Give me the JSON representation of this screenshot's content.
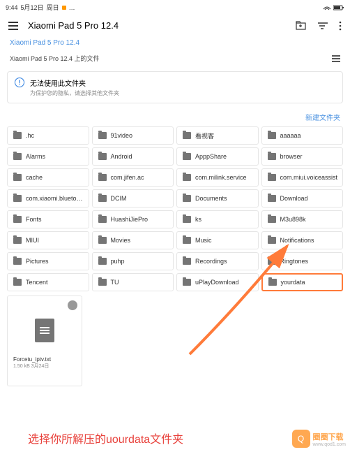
{
  "status": {
    "time": "9:44",
    "date": "5月12日",
    "day": "周日"
  },
  "header": {
    "title": "Xiaomi Pad 5 Pro 12.4"
  },
  "breadcrumb": "Xiaomi Pad 5 Pro 12.4",
  "path_label": "Xiaomi Pad 5 Pro 12.4 上的文件",
  "info": {
    "title": "无法使用此文件夹",
    "sub": "为保护您的隐私，请选择其他文件夹"
  },
  "new_folder": "新建文件夹",
  "folders": [
    ".hc",
    "91video",
    "看视客",
    "aaaaaa",
    "Alarms",
    "Android",
    "ApppShare",
    "browser",
    "cache",
    "com.jifen.ac",
    "com.milink.service",
    "com.miui.voiceassist",
    "com.xiaomi.blueto…",
    "DCIM",
    "Documents",
    "Download",
    "Fonts",
    "HuashiJiePro",
    "ks",
    "M3u898k",
    "MIUI",
    "Movies",
    "Music",
    "Notifications",
    "Pictures",
    "puhp",
    "Recordings",
    "Ringtones",
    "Tencent",
    "TU",
    "uPlayDownload",
    "yourdata"
  ],
  "highlighted_index": 31,
  "file": {
    "name": "Forcetu_iptv.txt",
    "meta": "1.50 kB 3月24日"
  },
  "caption": "选择你所解压的uourdata文件夹",
  "watermark": {
    "brand": "圈圈下载",
    "url": "www.qod1.com"
  }
}
